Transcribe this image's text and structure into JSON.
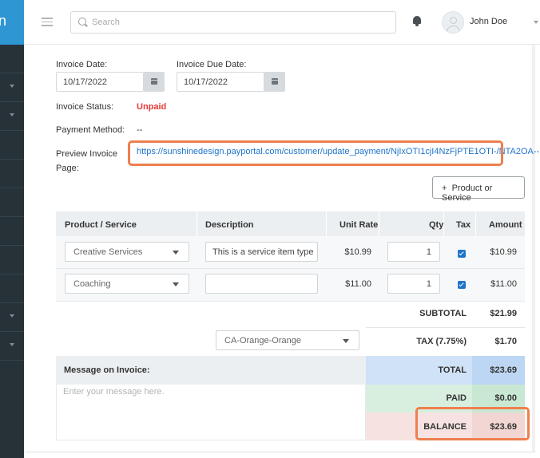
{
  "app": {
    "brand_letter": "n"
  },
  "header": {
    "search_placeholder": "Search",
    "user_name": "John Doe"
  },
  "invoice": {
    "invoice_date_label": "Invoice Date:",
    "invoice_date": "10/17/2022",
    "due_date_label": "Invoice Due Date:",
    "due_date": "10/17/2022",
    "status_label": "Invoice Status:",
    "status": "Unpaid",
    "payment_method_label": "Payment Method:",
    "payment_method": "--",
    "preview_label": "Preview Invoice Page:",
    "preview_url": "https://sunshinedesign.payportal.com/customer/update_payment/NjIxOTI1cjI4NzFjPTE1OTI-/NTA2OA--"
  },
  "add_item_button": "Product or Service",
  "add_icon": "+",
  "table": {
    "headers": {
      "product": "Product / Service",
      "description": "Description",
      "unit_rate": "Unit Rate",
      "qty": "Qty",
      "tax": "Tax",
      "amount": "Amount"
    },
    "rows": [
      {
        "product": "Creative Services",
        "description": "This is a service item type",
        "unit_rate": "$10.99",
        "qty": "1",
        "tax": true,
        "amount": "$10.99"
      },
      {
        "product": "Coaching",
        "description": "",
        "unit_rate": "$11.00",
        "qty": "1",
        "tax": true,
        "amount": "$11.00"
      }
    ]
  },
  "totals": {
    "subtotal_label": "SUBTOTAL",
    "subtotal": "$21.99",
    "tax_region": "CA-Orange-Orange",
    "tax_label": "TAX (7.75%)",
    "tax": "$1.70",
    "total_label": "TOTAL",
    "total": "$23.69",
    "paid_label": "PAID",
    "paid": "$0.00",
    "balance_label": "BALANCE",
    "balance": "$23.69"
  },
  "message": {
    "title": "Message on Invoice:",
    "placeholder": "Enter your message here."
  },
  "colors": {
    "status_unpaid": "#e53935",
    "link": "#1e74c9",
    "highlight": "#ee7f4f",
    "total_bg": "#cfe2f7",
    "paid_bg": "#d8efdf",
    "balance_bg": "#f6e3e1",
    "sidebar": "#263238"
  }
}
